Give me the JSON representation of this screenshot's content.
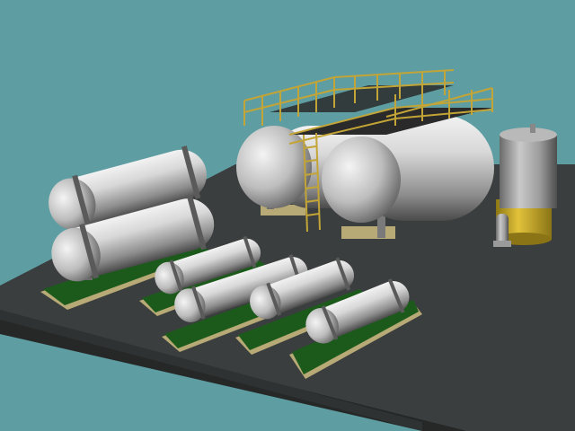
{
  "scene": {
    "colors": {
      "sky": "#5e9ea3",
      "platform_top": "#3b3e3e",
      "platform_edge": "#262828",
      "pad_green": "#1c5a1c",
      "pad_tan": "#b8aa76",
      "tank_light": "#e6e6e6",
      "tank_mid": "#a8a8a8",
      "tank_dark": "#4a4a4a",
      "railing": "#c2a437",
      "deck": "#2a2a2a",
      "yellow_base": "#d6b628"
    }
  }
}
